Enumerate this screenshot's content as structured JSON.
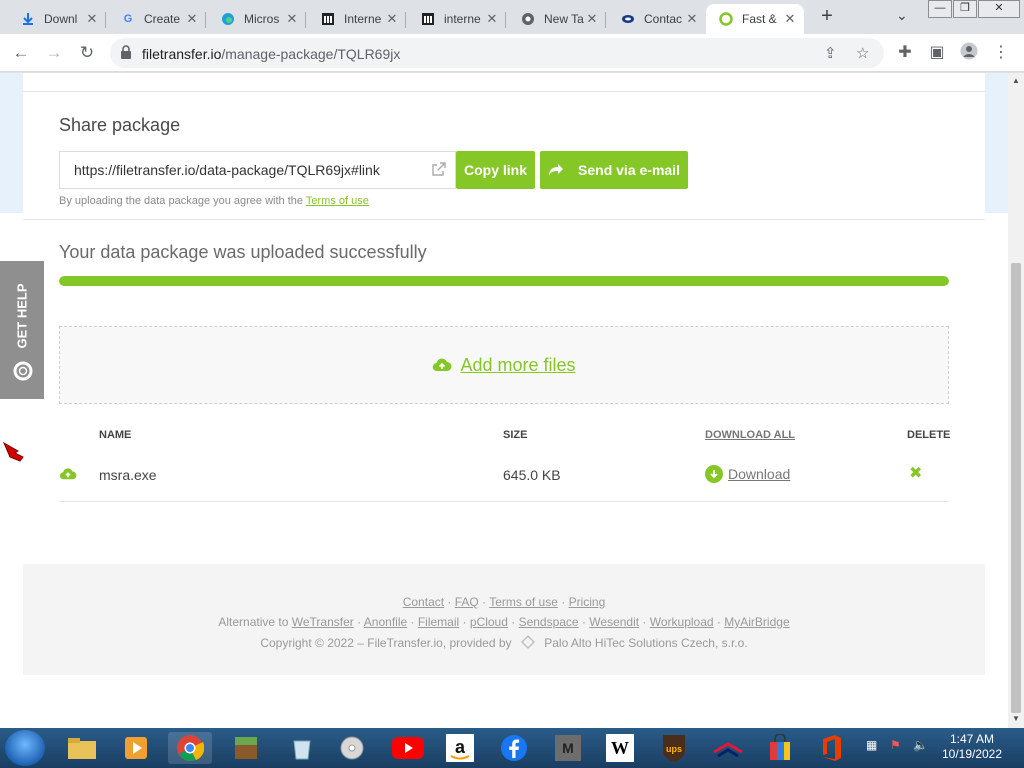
{
  "browser": {
    "tabs": [
      {
        "title": "Downl",
        "favicon": "download-icon"
      },
      {
        "title": "Create",
        "favicon": "google-icon"
      },
      {
        "title": "Micros",
        "favicon": "edge-icon"
      },
      {
        "title": "Interne",
        "favicon": "archive-icon"
      },
      {
        "title": "interne",
        "favicon": "archive-icon"
      },
      {
        "title": "New Ta",
        "favicon": "chrome-icon"
      },
      {
        "title": "Contac",
        "favicon": "contact-icon"
      },
      {
        "title": "Fast &",
        "favicon": "filetransfer-icon",
        "active": true
      }
    ],
    "url_domain": "filetransfer.io",
    "url_path": "/manage-package/TQLR69jx"
  },
  "page": {
    "share_title": "Share package",
    "share_link": "https://filetransfer.io/data-package/TQLR69jx#link",
    "copy_link_label": "Copy link",
    "send_email_label": "Send via e-mail",
    "agree_text": "By uploading the data package you agree with the",
    "terms_link": "Terms of use",
    "success_title": "Your data package was uploaded successfully",
    "upload_progress": 1.0,
    "add_more_files": "Add more files",
    "table": {
      "headers": {
        "name": "NAME",
        "size": "SIZE",
        "download_all": "DOWNLOAD ALL",
        "delete": "DELETE"
      },
      "rows": [
        {
          "name": "msra.exe",
          "size": "645.0 KB",
          "download": "Download"
        }
      ]
    },
    "get_help": "GET HELP"
  },
  "footer": {
    "links": [
      "Contact",
      "FAQ",
      "Terms of use",
      "Pricing"
    ],
    "alt_prefix": "Alternative to",
    "alternatives": [
      "WeTransfer",
      "Anonfile",
      "Filemail",
      "pCloud",
      "Sendspace",
      "Wesendit",
      "Workupload",
      "MyAirBridge"
    ],
    "copyright": "Copyright © 2022 – FileTransfer.io, provided by",
    "provider": "Palo Alto HiTec Solutions Czech, s.r.o."
  },
  "taskbar": {
    "time": "1:47 AM",
    "date": "10/19/2022"
  },
  "colors": {
    "accent": "#86c728",
    "help_tab": "#8f8f8f"
  }
}
